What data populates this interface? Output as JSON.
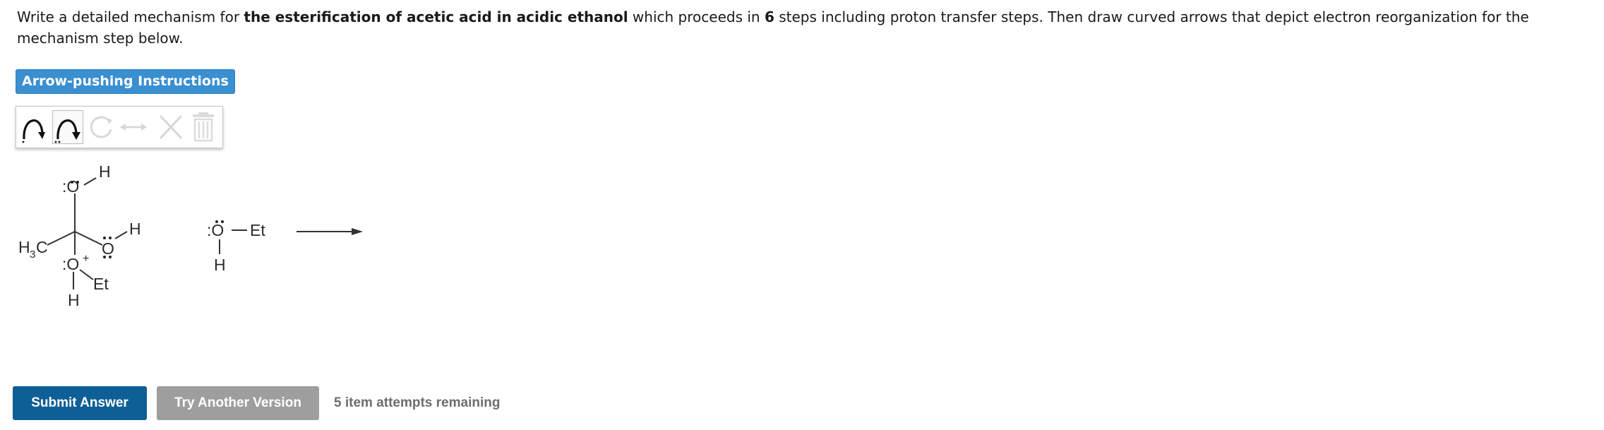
{
  "question": {
    "text_1": "Write a detailed mechanism for ",
    "bold_1": "the esterification of acetic acid in acidic ethanol",
    "text_2": " which proceeds in ",
    "bold_2": "6",
    "text_3": " steps including proton transfer steps. Then draw curved arrows that depict electron reorganization for the mechanism step below."
  },
  "instructions_button": {
    "label": "Arrow-pushing Instructions"
  },
  "toolbar": {
    "tools": [
      {
        "name": "single-electron-arrow-icon",
        "state": "enabled"
      },
      {
        "name": "electron-pair-arrow-icon",
        "state": "selected"
      },
      {
        "name": "rotate-icon",
        "state": "disabled"
      },
      {
        "name": "resonance-arrow-icon",
        "state": "disabled"
      },
      {
        "name": "delete-icon",
        "state": "disabled"
      },
      {
        "name": "trash-icon",
        "state": "disabled"
      }
    ]
  },
  "molecule1": {
    "h_top": "H",
    "o_top": ":O",
    "ch3": "H",
    "ch3_sub": "3",
    "ch3_c": "C",
    "o_right": "O",
    "h_right": "H",
    "o_bottom": ":O",
    "charge": "+",
    "et": "Et",
    "h_bottom": "H"
  },
  "molecule2": {
    "o": ":O",
    "et": "Et",
    "h": "H"
  },
  "actions": {
    "submit_label": "Submit Answer",
    "another_label": "Try Another Version",
    "attempts_text": "5 item attempts remaining"
  },
  "colors": {
    "instructions_bg": "#3a8fd0",
    "submit_bg": "#0e5f96",
    "another_bg": "#9e9e9e",
    "attempts_text": "#6d6d6d"
  }
}
